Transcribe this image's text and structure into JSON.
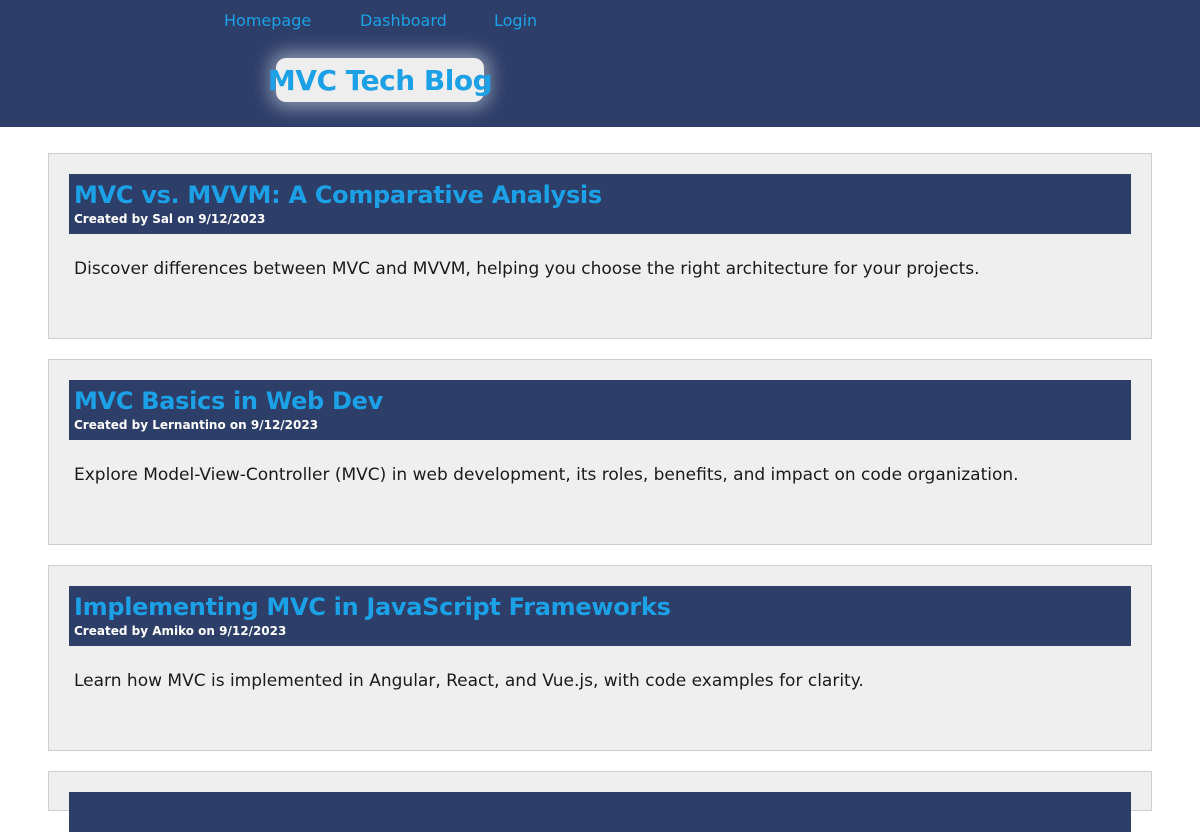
{
  "nav": {
    "items": [
      {
        "label": "Homepage"
      },
      {
        "label": "Dashboard"
      },
      {
        "label": "Login"
      }
    ]
  },
  "site": {
    "title": "MVC Tech Blog"
  },
  "posts": [
    {
      "title": "MVC vs. MVVM: A Comparative Analysis",
      "meta": "Created by Sal on 9/12/2023",
      "body": "Discover differences between MVC and MVVM, helping you choose the right architecture for your projects."
    },
    {
      "title": "MVC Basics in Web Dev",
      "meta": "Created by Lernantino on 9/12/2023",
      "body": "Explore Model-View-Controller (MVC) in web development, its roles, benefits, and impact on code organization."
    },
    {
      "title": "Implementing MVC in JavaScript Frameworks",
      "meta": "Created by Amiko on 9/12/2023",
      "body": "Learn how MVC is implemented in Angular, React, and Vue.js, with code examples for clarity."
    }
  ],
  "colors": {
    "header_bg": "#2d3e69",
    "accent": "#1ca0e6",
    "card_bg": "#efefef"
  }
}
